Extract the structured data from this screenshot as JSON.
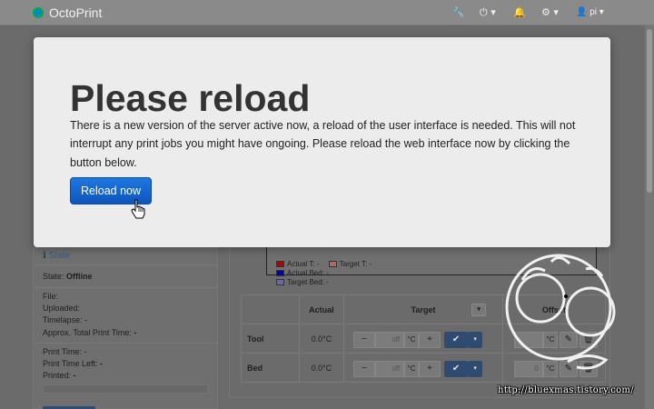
{
  "navbar": {
    "brand": "OctoPrint",
    "user": "pi",
    "icons": [
      "wrench-icon",
      "power-icon",
      "bell-icon",
      "settings-sliders-icon",
      "user-icon"
    ]
  },
  "modal": {
    "title": "Please reload",
    "body": "There is a new version of the server active now, a reload of the user interface is needed. This will not interrupt any print jobs you might have ongoing. Please reload the web interface now by clicking the button below.",
    "button_label": "Reload now",
    "button_color": "#1464cc"
  },
  "state_panel": {
    "heading": "State",
    "state_label": "State:",
    "state_value": "Offline",
    "file_label": "File:",
    "uploaded_label": "Uploaded:",
    "timelapse_label": "Timelapse: -",
    "approx_label": "Approx. Total Print Time:",
    "approx_value": "-",
    "print_time": "Print Time: -",
    "print_time_left_label": "Print Time Left:",
    "print_time_left_value": "-",
    "printed_label": "Printed:",
    "printed_value": "-"
  },
  "temperature": {
    "legend": [
      {
        "label": "Actual T: -",
        "color": "#c00000"
      },
      {
        "label": "Target T: -",
        "color": "#c07070"
      },
      {
        "label": "Actual Bed: -",
        "color": "#0000c0"
      },
      {
        "label": "Target Bed: -",
        "color": "#7070c0"
      }
    ],
    "columns": {
      "actual": "Actual",
      "target": "Target",
      "offset": "Offset"
    },
    "rows": [
      {
        "name": "Tool",
        "actual": "0.0°C",
        "target_value": "off",
        "unit": "°C",
        "offset_value": "",
        "offset_unit": "°C"
      },
      {
        "name": "Bed",
        "actual": "0.0°C",
        "target_value": "off",
        "unit": "°C",
        "offset_value": "0",
        "offset_unit": "°C"
      }
    ]
  },
  "watermark": {
    "url": "http://bluexmas.tistory.com/"
  }
}
